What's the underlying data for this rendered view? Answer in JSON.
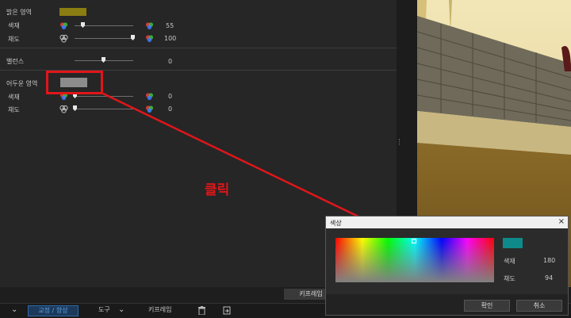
{
  "panel": {
    "highlights_label": "밝은 영역",
    "highlights_color": "#8a7d12",
    "hl_hue_label": "색재",
    "hl_hue_value": "55",
    "hl_sat_label": "채도",
    "hl_sat_value": "100",
    "balance_label": "밸런스",
    "balance_value": "0",
    "shadows_label": "어두운 영역",
    "shadows_color": "#8c8c8c",
    "sh_hue_label": "색재",
    "sh_hue_value": "0",
    "sh_sat_label": "채도",
    "sh_sat_value": "0"
  },
  "annotation": {
    "click_text": "클릭",
    "color": "#e0161a"
  },
  "dialog": {
    "title": "색상",
    "close_icon": "×",
    "preview_color": "#0e8a8a",
    "hue_label": "색재",
    "hue_value": "180",
    "sat_label": "채도",
    "sat_value": "94",
    "ok_label": "확인",
    "cancel_label": "취소"
  },
  "bottom": {
    "keyframe_label": "키프레임",
    "chevron_icon": "⌄",
    "correction_tab": "교정 / 향상",
    "tools_label": "도구",
    "keyframe_tab": "키프레임",
    "delete_icon": "trash-icon",
    "export_icon": "export-icon"
  }
}
